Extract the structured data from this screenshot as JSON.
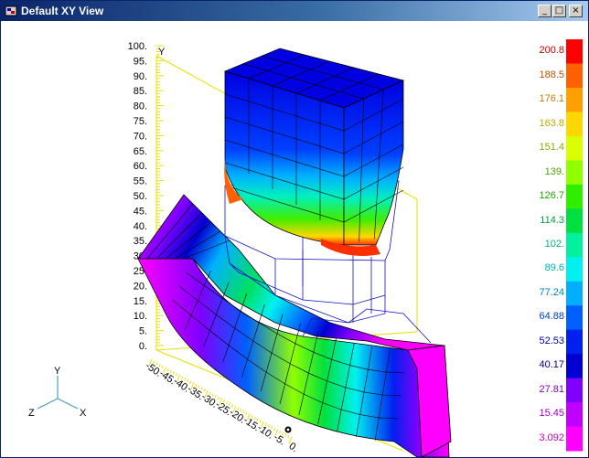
{
  "window": {
    "title": "Default XY View",
    "buttons": {
      "minimize": "_",
      "maximize": "□",
      "close": "×"
    }
  },
  "legend": {
    "values": [
      "200.8",
      "188.5",
      "176.1",
      "163.8",
      "151.4",
      "139.",
      "126.7",
      "114.3",
      "102.",
      "89.6",
      "77.24",
      "64.88",
      "52.53",
      "40.17",
      "27.81",
      "15.45",
      "3.092"
    ],
    "colors": [
      "#ff0000",
      "#ff6000",
      "#ffa000",
      "#ffd700",
      "#d9ff00",
      "#90ff00",
      "#30ee00",
      "#00e040",
      "#00f0a0",
      "#00f0f0",
      "#00b0ff",
      "#0060ff",
      "#0020f0",
      "#0000d0",
      "#8000ff",
      "#c000ff",
      "#ff00ff"
    ],
    "label_colors": [
      "#c00000",
      "#c05000",
      "#c08000",
      "#c0a800",
      "#90a800",
      "#50a000",
      "#20a000",
      "#00a040",
      "#00b080",
      "#00b0b0",
      "#0080c0",
      "#0040c0",
      "#0000a0",
      "#000080",
      "#8000c0",
      "#a000c0",
      "#c000c0"
    ]
  },
  "axes": {
    "y_axis_label": "Y",
    "y_ticks": [
      "100.",
      "95.",
      "90.",
      "85.",
      "80.",
      "75.",
      "70.",
      "65.",
      "60.",
      "55.",
      "50.",
      "45.",
      "40.",
      "35.",
      "30.",
      "25.",
      "20.",
      "15.",
      "10.",
      "5.",
      "0."
    ],
    "x_ticks": [
      "-50.",
      "-45.",
      "-40.",
      "-35.",
      "-30.",
      "-25.",
      "-20.",
      "-15.",
      "-10.",
      "-5.",
      "0."
    ]
  },
  "triad": {
    "x": "X",
    "y": "Y",
    "z": "Z"
  }
}
